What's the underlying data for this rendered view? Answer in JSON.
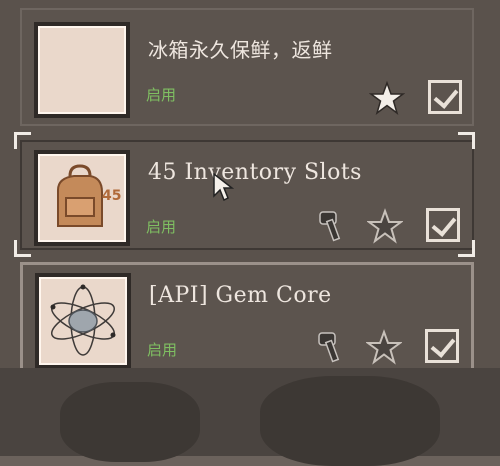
{
  "mods": [
    {
      "title": "冰箱永久保鲜，返鲜",
      "status": "启用"
    },
    {
      "title": "45 Inventory Slots",
      "status": "启用"
    },
    {
      "title": "[API] Gem Core",
      "status": "启用"
    }
  ],
  "icons": {
    "favorite": "star-icon",
    "enabled": "checkbox-icon",
    "workshop": "hammer-icon"
  },
  "colors": {
    "status_enabled": "#7fbf62",
    "card_bg": "#5c544e",
    "text": "#eee6df"
  }
}
